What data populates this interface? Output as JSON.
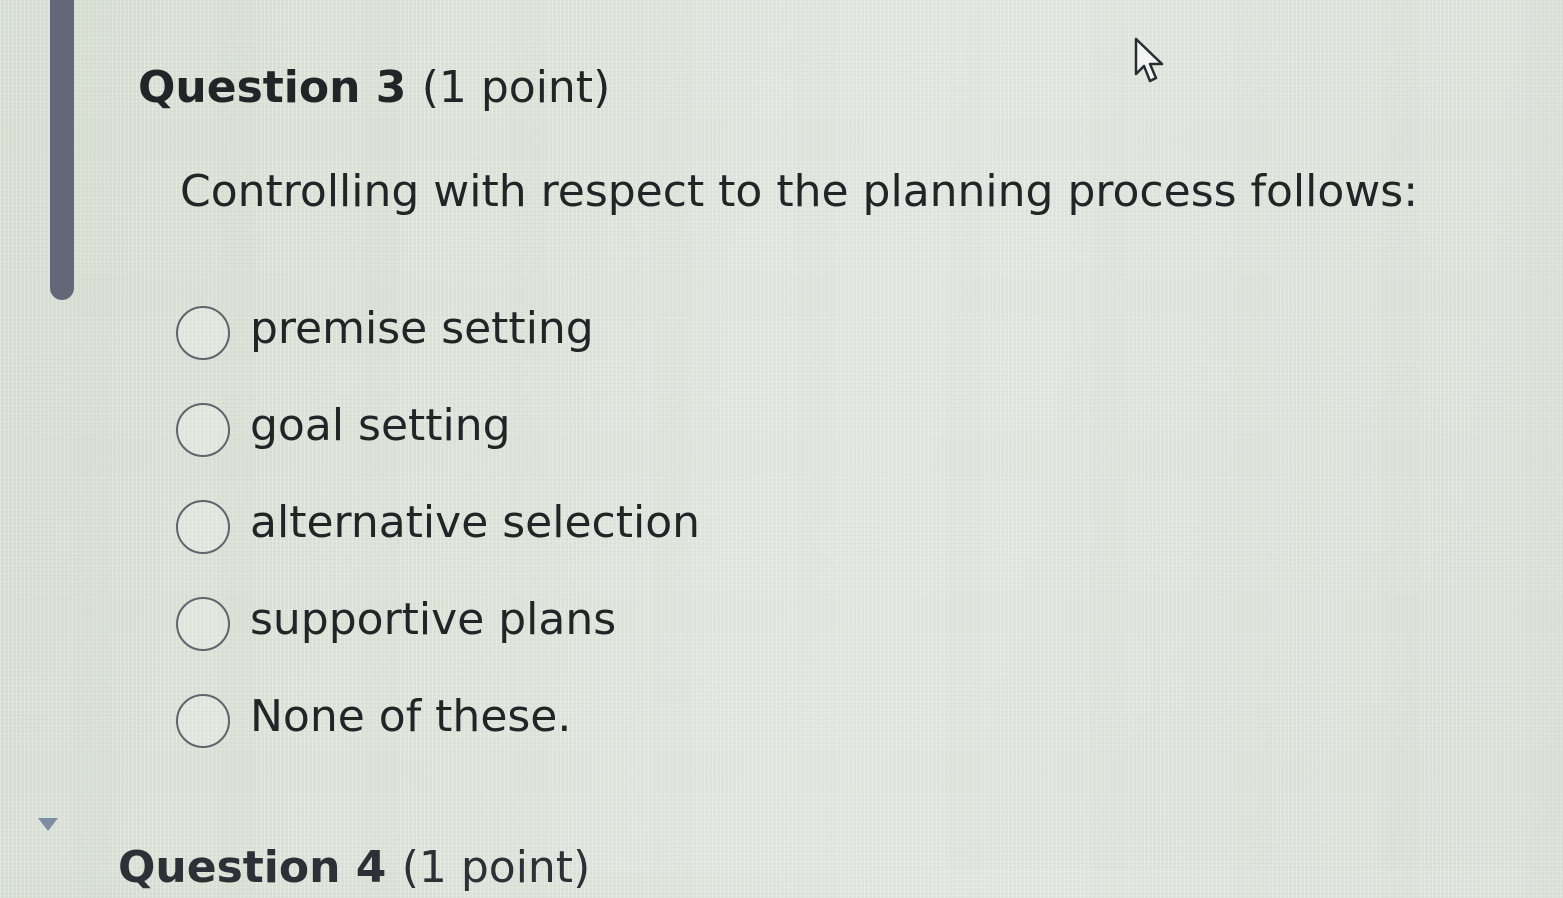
{
  "question": {
    "title": "Question 3",
    "points": "(1 point)",
    "text": "Controlling with respect to the planning process follows:"
  },
  "options": [
    {
      "label": "premise setting",
      "selected": false
    },
    {
      "label": "goal setting",
      "selected": false
    },
    {
      "label": "alternative selection",
      "selected": false
    },
    {
      "label": "supportive plans",
      "selected": false
    },
    {
      "label": "None of these.",
      "selected": false
    }
  ],
  "next_question": {
    "title": "Question 4",
    "points": "(1 point)"
  },
  "icons": {
    "cursor": "mouse-pointer-icon",
    "collapse": "triangle-down-icon",
    "radio": "radio-unchecked-icon"
  },
  "colors": {
    "text": "#222428",
    "scroll_indicator": "#62677a",
    "collapse_arrow": "#7c8ea6",
    "radio_border": "#60646e"
  }
}
